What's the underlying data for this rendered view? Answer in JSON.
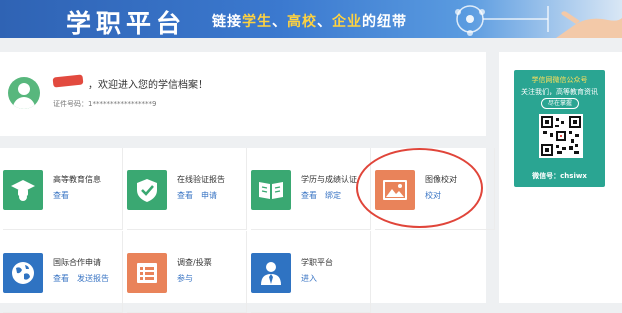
{
  "banner": {
    "brand": "学职平台",
    "tagline": {
      "part1": "链接",
      "hl1": "学生",
      "sep1": "、",
      "hl2": "高校",
      "sep2": "、",
      "hl3": "企业",
      "part2": "的纽带"
    }
  },
  "welcome": {
    "greeting": "，欢迎进入您的学信档案！",
    "id_label": "证件号码：1*****************9"
  },
  "tiles": [
    {
      "name": "高等教育信息",
      "links": [
        "查看"
      ],
      "color": "#3aa872",
      "icon": "graduate-icon"
    },
    {
      "name": "在线验证报告",
      "links": [
        "查看",
        "申请"
      ],
      "color": "#3aa872",
      "icon": "shield-check-icon"
    },
    {
      "name": "学历与成绩认证",
      "links": [
        "查看",
        "绑定"
      ],
      "color": "#3aa872",
      "icon": "book-icon"
    },
    {
      "name": "图像校对",
      "links": [
        "校对"
      ],
      "color": "#e9835a",
      "icon": "image-icon"
    },
    {
      "name": "国际合作申请",
      "links": [
        "查看",
        "发送报告"
      ],
      "color": "#2f73c2",
      "icon": "globe-icon"
    },
    {
      "name": "调查/投票",
      "links": [
        "参与"
      ],
      "color": "#e9835a",
      "icon": "list-icon"
    },
    {
      "name": "学职平台",
      "links": [
        "进入"
      ],
      "color": "#2f73c2",
      "icon": "suit-person-icon"
    }
  ],
  "qr": {
    "title": "学信网微信公众号",
    "subtitle": "关注我们，高等教育资讯",
    "pill": "尽在掌握",
    "wechat_id": "微信号：chsiwx"
  }
}
